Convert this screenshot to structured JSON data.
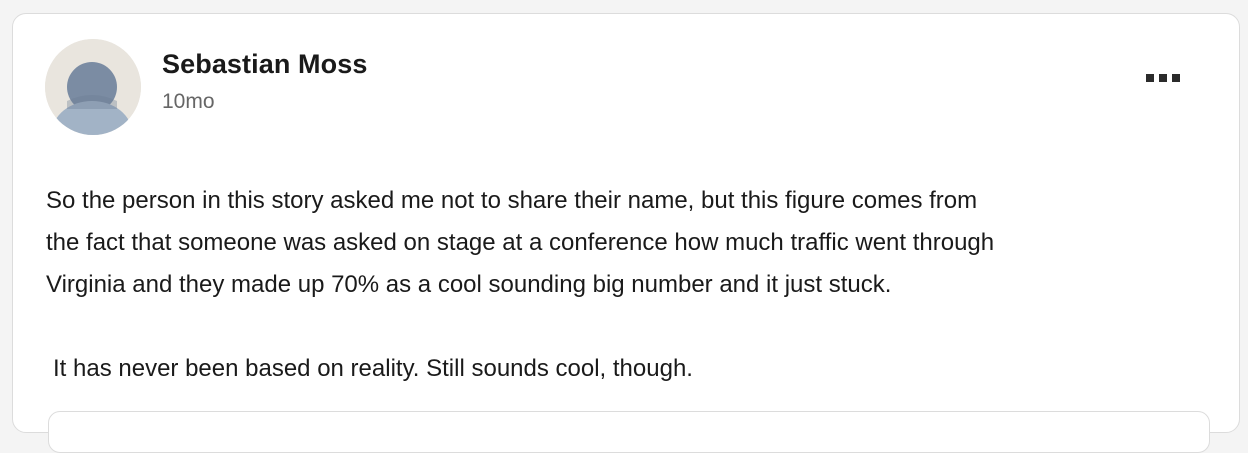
{
  "post": {
    "author": "Sebastian Moss",
    "timestamp": "10mo",
    "paragraphs": [
      "So the person in this story asked me not to share their name, but this figure comes from",
      "the fact that someone was asked on stage at a conference how much traffic went through",
      "Virginia and they made up 70% as a cool sounding big number and it just stuck.",
      "It has never been based on reality. Still sounds cool, though."
    ]
  },
  "icons": {
    "avatar": "default-avatar-icon",
    "menu": "more-options-icon"
  },
  "colors": {
    "avatar_bg": "#e9e5de",
    "avatar_figure": "#8a9bb0",
    "text": "#1a1a1a",
    "muted": "#666666"
  }
}
